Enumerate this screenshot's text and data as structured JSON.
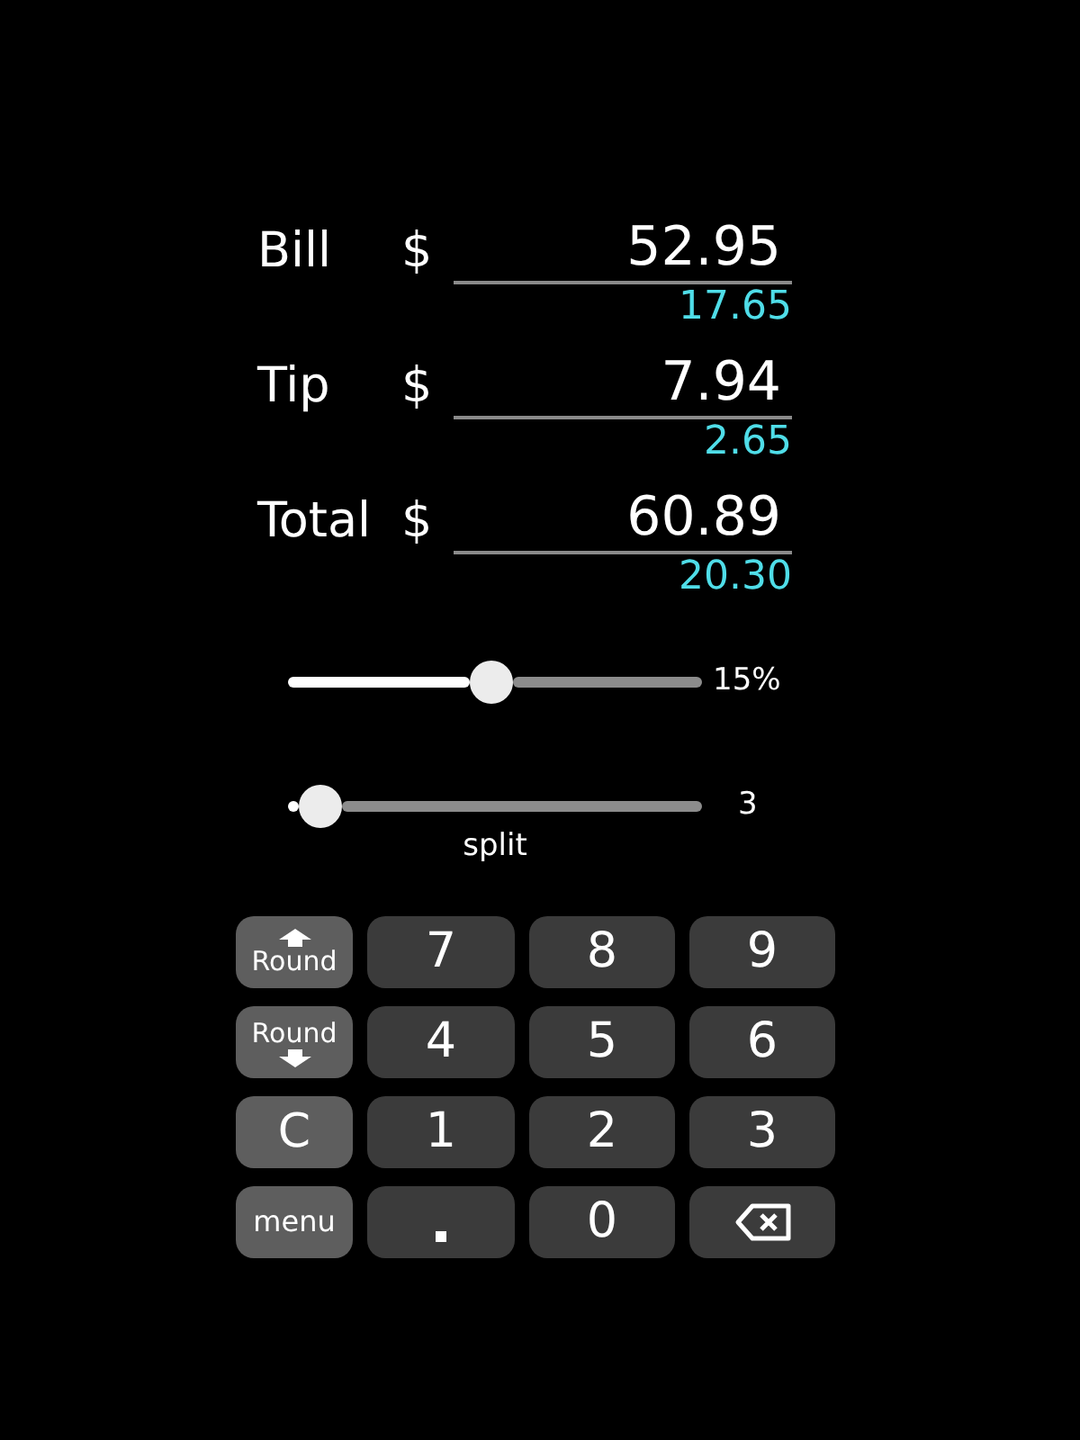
{
  "rows": [
    {
      "label": "Bill",
      "currency": "$",
      "value": "52.95",
      "per_person": "17.65"
    },
    {
      "label": "Tip",
      "currency": "$",
      "value": "7.94",
      "per_person": "2.65"
    },
    {
      "label": "Total",
      "currency": "$",
      "value": "60.89",
      "per_person": "20.30"
    }
  ],
  "tip_slider": {
    "level": 0.49,
    "reading": "15%"
  },
  "split_slider": {
    "level": 0.08,
    "reading": "3",
    "label": "split"
  },
  "keys": [
    {
      "kind": "round-up",
      "label": "Round"
    },
    {
      "kind": "digit",
      "label": "7"
    },
    {
      "kind": "digit",
      "label": "8"
    },
    {
      "kind": "digit",
      "label": "9"
    },
    {
      "kind": "round-down",
      "label": "Round"
    },
    {
      "kind": "digit",
      "label": "4"
    },
    {
      "kind": "digit",
      "label": "5"
    },
    {
      "kind": "digit",
      "label": "6"
    },
    {
      "kind": "function",
      "label": "C"
    },
    {
      "kind": "digit",
      "label": "1"
    },
    {
      "kind": "digit",
      "label": "2"
    },
    {
      "kind": "digit",
      "label": "3"
    },
    {
      "kind": "function",
      "label": "menu"
    },
    {
      "kind": "dot"
    },
    {
      "kind": "digit",
      "label": "0"
    },
    {
      "kind": "backspace"
    }
  ]
}
